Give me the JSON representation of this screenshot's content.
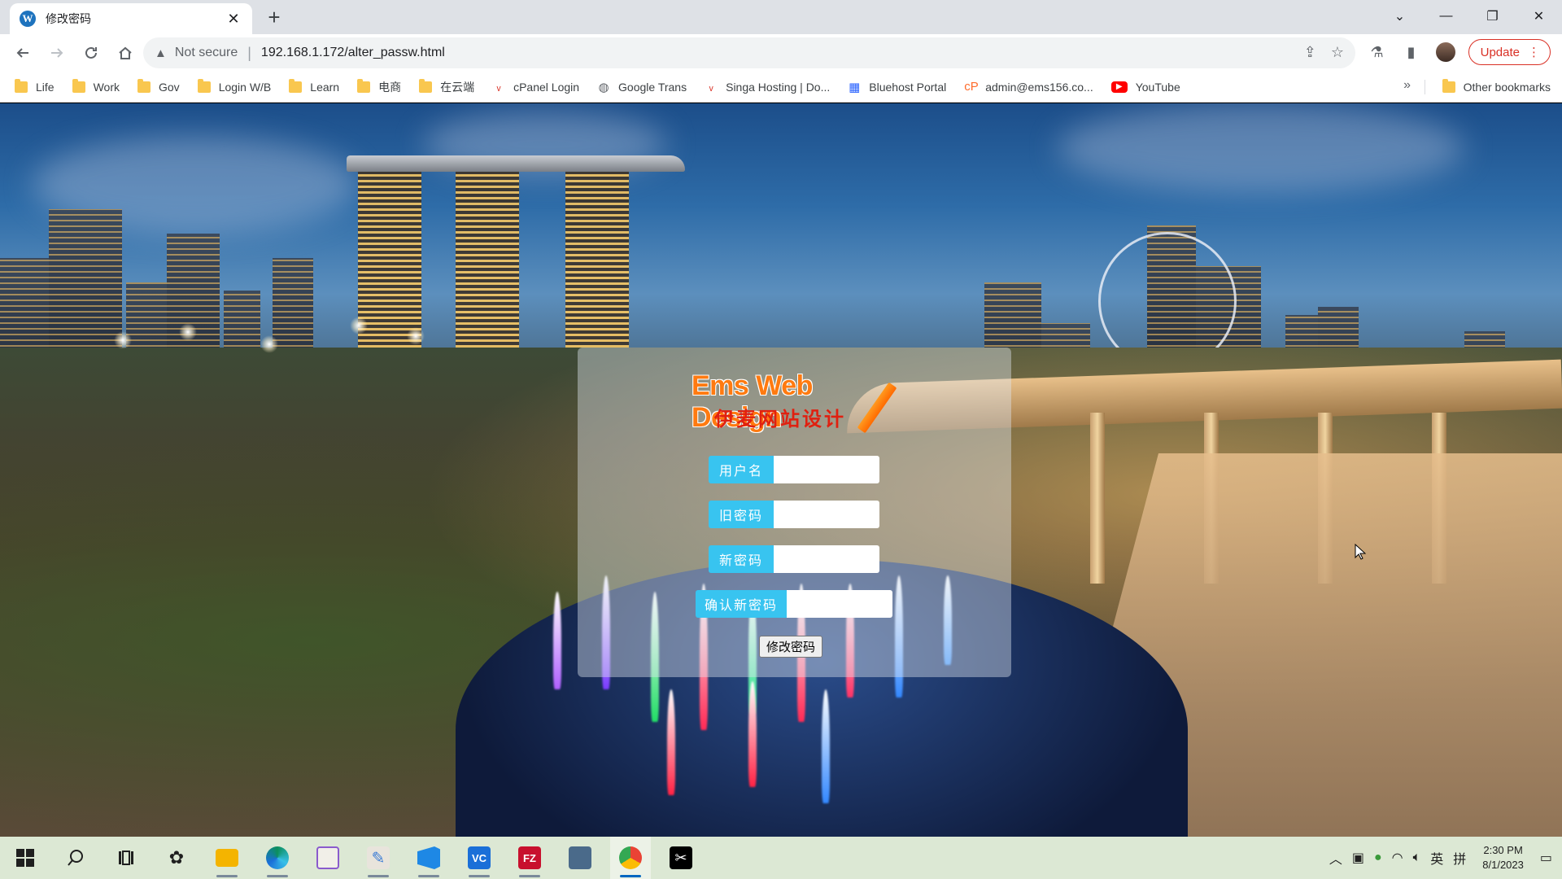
{
  "browser": {
    "tab": {
      "favicon": "W",
      "title": "修改密码",
      "close": "✕"
    },
    "new_tab": "+",
    "window_controls": {
      "dropdown": "⌄",
      "minimize": "—",
      "restore": "❐",
      "close": "✕"
    },
    "toolbar": {
      "security_label": "Not secure",
      "url": "192.168.1.172/alter_passw.html",
      "update_label": "Update"
    },
    "bookmarks": [
      {
        "label": "Life",
        "icon": "folder-icon"
      },
      {
        "label": "Work",
        "icon": "folder-icon"
      },
      {
        "label": "Gov",
        "icon": "folder-icon"
      },
      {
        "label": "Login W/B",
        "icon": "folder-icon"
      },
      {
        "label": "Learn",
        "icon": "folder-icon"
      },
      {
        "label": "电商",
        "icon": "folder-icon"
      },
      {
        "label": "在云端",
        "icon": "folder-icon"
      },
      {
        "label": "cPanel Login",
        "icon": "cpanel-icon"
      },
      {
        "label": "Google Trans",
        "icon": "globe-icon"
      },
      {
        "label": "Singa Hosting | Do...",
        "icon": "hosting-icon"
      },
      {
        "label": "Bluehost Portal",
        "icon": "grid-icon"
      },
      {
        "label": "admin@ems156.co...",
        "icon": "cpanel-mail-icon"
      },
      {
        "label": "YouTube",
        "icon": "youtube-icon"
      }
    ],
    "bookmarks_more": "»",
    "other_bookmarks": "Other bookmarks"
  },
  "page": {
    "logo": {
      "en": "Ems Web Design",
      "cn": "伊麦网站设计"
    },
    "form": {
      "username_label": "用户名",
      "old_password_label": "旧密码",
      "new_password_label": "新密码",
      "confirm_password_label": "确认新密码",
      "submit_label": "修改密码"
    }
  },
  "taskbar": {
    "apps": [
      {
        "name": "start",
        "icon": "windows-icon"
      },
      {
        "name": "search",
        "icon": "search-icon"
      },
      {
        "name": "task-view",
        "icon": "task-view-icon"
      },
      {
        "name": "widgets",
        "icon": "widgets-icon"
      },
      {
        "name": "file-explorer",
        "icon": "folder-icon"
      },
      {
        "name": "edge",
        "icon": "edge-icon"
      },
      {
        "name": "notepad",
        "icon": "notepad-icon"
      },
      {
        "name": "paint",
        "icon": "paint-icon"
      },
      {
        "name": "vscode",
        "icon": "vscode-icon"
      },
      {
        "name": "vc",
        "icon": "vc-icon",
        "text": "VC"
      },
      {
        "name": "filezilla",
        "icon": "filezilla-icon",
        "text": "FZ"
      },
      {
        "name": "network",
        "icon": "network-icon"
      },
      {
        "name": "chrome",
        "icon": "chrome-icon"
      },
      {
        "name": "capcut",
        "icon": "capcut-icon"
      }
    ],
    "tray": {
      "ime_lang": "英",
      "ime_mode": "拼",
      "time": "2:30 PM",
      "date": "8/1/2023"
    }
  }
}
